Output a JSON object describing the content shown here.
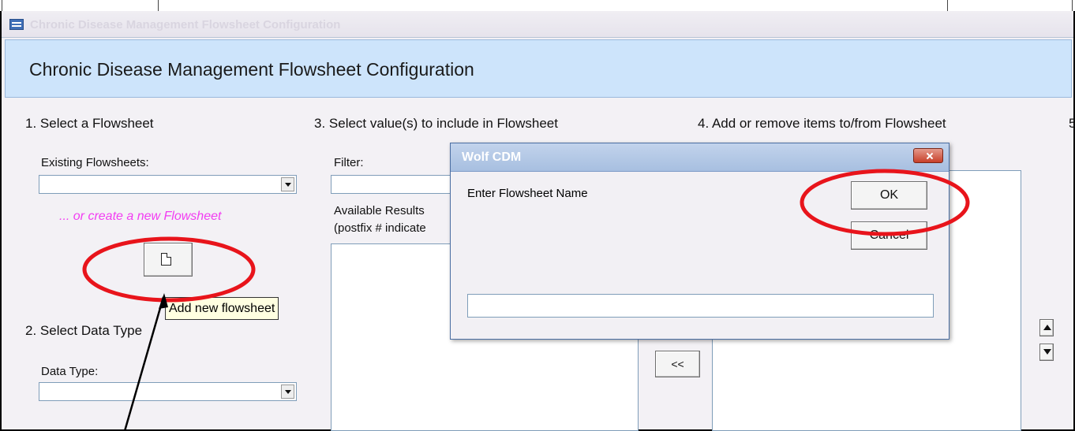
{
  "window": {
    "title": "Chronic Disease Management Flowsheet Configuration",
    "icon": "form-icon"
  },
  "form": {
    "header_title": "Chronic Disease Management Flowsheet Configuration"
  },
  "section1": {
    "heading": "1. Select a  Flowsheet",
    "existing_label": "Existing Flowsheets:",
    "existing_value": "",
    "create_link": "... or create a new  Flowsheet",
    "new_button_icon": "new-document-icon",
    "tooltip": "Add new flowsheet"
  },
  "section2": {
    "heading": "2. Select Data Type",
    "data_type_label": "Data Type:",
    "data_type_value": ""
  },
  "section3": {
    "heading": "3. Select value(s) to include in Flowsheet",
    "filter_label": "Filter:",
    "available_label": "Available Results",
    "postfix_note": "(postfix # indicate"
  },
  "section4": {
    "heading": "4. Add or remove items to/from Flowsheet",
    "remove_button": "<<",
    "move_up_icon": "arrow-up-icon",
    "move_down_icon": "arrow-down-icon"
  },
  "section5": {
    "heading_fragment": "5"
  },
  "dialog": {
    "title": "Wolf CDM",
    "prompt": "Enter Flowsheet Name",
    "ok_label": "OK",
    "cancel_label": "Cancel",
    "name_value": "",
    "close_icon": "close-icon"
  },
  "annotations": {
    "highlight_color": "#e8141b",
    "arrow_color": "#000000"
  }
}
